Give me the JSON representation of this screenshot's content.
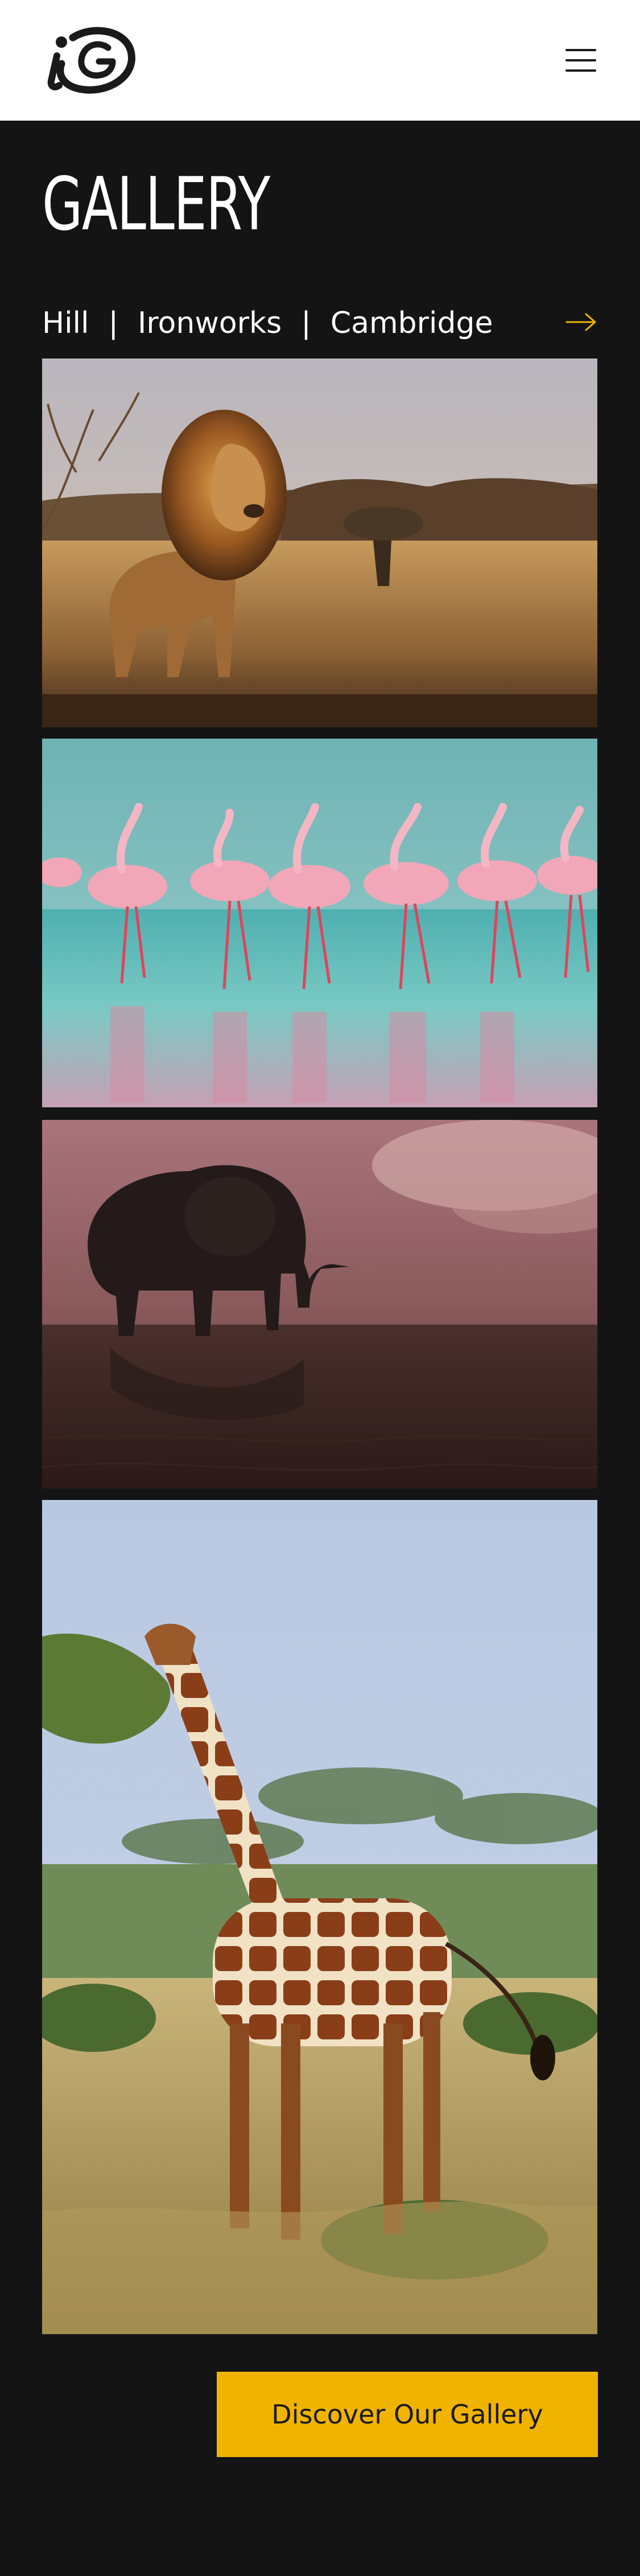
{
  "header": {
    "logo_icon": "ig-logo",
    "menu_icon": "hamburger-menu-icon"
  },
  "page": {
    "title": "GALLERY"
  },
  "breadcrumb": {
    "items": [
      "Hill",
      "Ironworks",
      "Cambridge"
    ],
    "separator": "|",
    "next_icon": "arrow-right-icon"
  },
  "gallery": {
    "photos": [
      {
        "subject": "lion"
      },
      {
        "subject": "flamingos"
      },
      {
        "subject": "elephant"
      },
      {
        "subject": "giraffe"
      }
    ]
  },
  "cta": {
    "label": "Discover Our Gallery"
  },
  "colors": {
    "page_background": "#141414",
    "header_background": "#ffffff",
    "accent": "#f0b300"
  }
}
